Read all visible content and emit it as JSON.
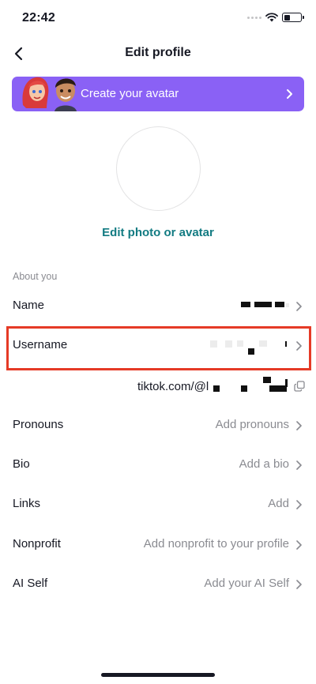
{
  "status_bar": {
    "time": "22:42"
  },
  "header": {
    "title": "Edit profile"
  },
  "banner": {
    "label": "Create your avatar"
  },
  "photo": {
    "edit_label": "Edit photo or avatar"
  },
  "section": {
    "about_label": "About you"
  },
  "rows": [
    {
      "label": "Name",
      "value": ""
    },
    {
      "label": "Username",
      "value": ""
    },
    {
      "label": "Pronouns",
      "value": "Add pronouns"
    },
    {
      "label": "Bio",
      "value": "Add a bio"
    },
    {
      "label": "Links",
      "value": "Add"
    },
    {
      "label": "Nonprofit",
      "value": "Add nonprofit to your profile"
    },
    {
      "label": "AI Self",
      "value": "Add your AI Self"
    }
  ],
  "profile_link": {
    "prefix": "tiktok.com/@l"
  },
  "colors": {
    "accent_purple": "#8a61f5",
    "link_teal": "#127b82",
    "highlight_red": "#e53a26"
  },
  "icons": [
    "back-arrow-icon",
    "wifi-icon",
    "battery-icon",
    "chevron-right-icon",
    "copy-icon"
  ]
}
